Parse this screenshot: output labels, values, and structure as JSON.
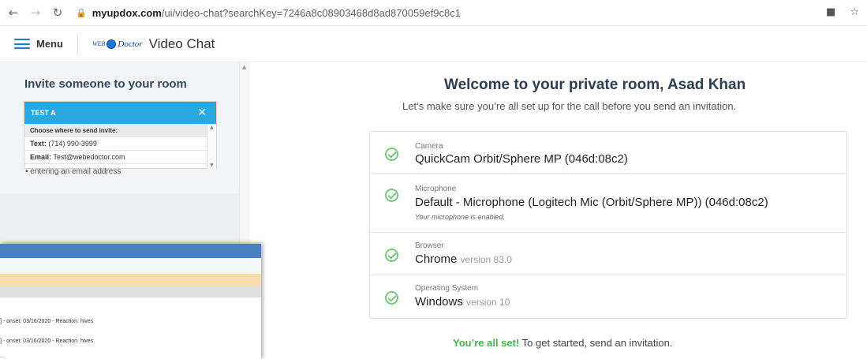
{
  "browser": {
    "url_host": "myupdox.com",
    "url_path": "/ui/video-chat?searchKey=7246a8c08903468d8ad870059ef9c8c1"
  },
  "header": {
    "menu_label": "Menu",
    "logo_web": "WEB",
    "logo_doctor": "Doctor",
    "title": "Video Chat"
  },
  "invite": {
    "title": "Invite someone to your room",
    "contact_name": "TEST A",
    "choose_label": "Choose where to send invite:",
    "text_label": "Text:",
    "text_value": "(714) 990-3999",
    "email_label": "Email:",
    "email_value": "Test@webedoctor.com",
    "hint": "• entering an email address"
  },
  "overlay": {
    "line1": "] - onset: 03/16/2020 - Reaction: hives",
    "line2": "] - onset: 03/16/2020 - Reaction: hives",
    "line3": "..."
  },
  "main": {
    "welcome": "Welcome to your private room, Asad Khan",
    "subtitle": "Let’s make sure you’re all set up for the call before you send an invitation.",
    "checks": [
      {
        "label": "Camera",
        "value": "QuickCam Orbit/Sphere MP (046d:08c2)",
        "version": "",
        "note": ""
      },
      {
        "label": "Microphone",
        "value": "Default - Microphone (Logitech Mic (Orbit/Sphere MP)) (046d:08c2)",
        "version": "",
        "note": "Your microphone is enabled."
      },
      {
        "label": "Browser",
        "value": "Chrome",
        "version": "version 83.0",
        "note": ""
      },
      {
        "label": "Operating System",
        "value": "Windows",
        "version": "version 10",
        "note": ""
      }
    ],
    "all_set_green": "You’re all set!",
    "all_set_rest": " To get started, send an invitation."
  },
  "colors": {
    "accent_blue": "#29a8e0",
    "success_green": "#4caf50",
    "heading": "#2c3e50"
  }
}
